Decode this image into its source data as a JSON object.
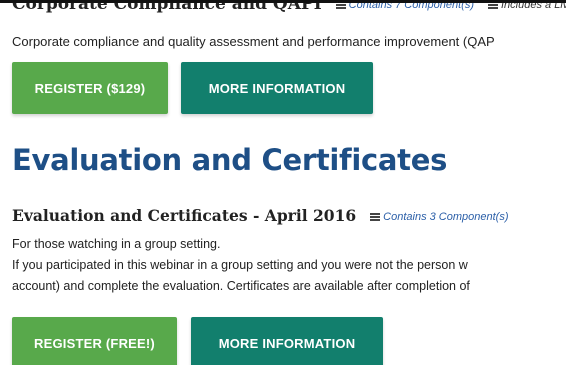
{
  "section_prev": {
    "title": "Corporate Compliance and QAPI",
    "components_link": "Contains 7 Component(s)",
    "live_link": "Includes a Live",
    "description": "Corporate compliance and quality assessment and performance improvement (QAP",
    "register_label": "REGISTER ($129)",
    "more_info_label": "MORE INFORMATION"
  },
  "heading": "Evaluation and Certificates",
  "section_eval": {
    "title": "Evaluation and Certificates - April 2016",
    "components_link": "Contains 3 Component(s)",
    "line1": "For those watching in a group setting.",
    "line2": "If you participated in this webinar in a group setting and you were not the person w",
    "line3": "account) and complete the evaluation. Certificates are available after completion of",
    "register_label": "REGISTER (FREE!)",
    "more_info_label": "MORE INFORMATION"
  },
  "colors": {
    "register_green": "#58a94b",
    "more_info_teal": "#127f6d",
    "heading_blue": "#1e4f86",
    "link_blue": "#2b5fa8"
  },
  "icons": [
    "list-icon"
  ]
}
